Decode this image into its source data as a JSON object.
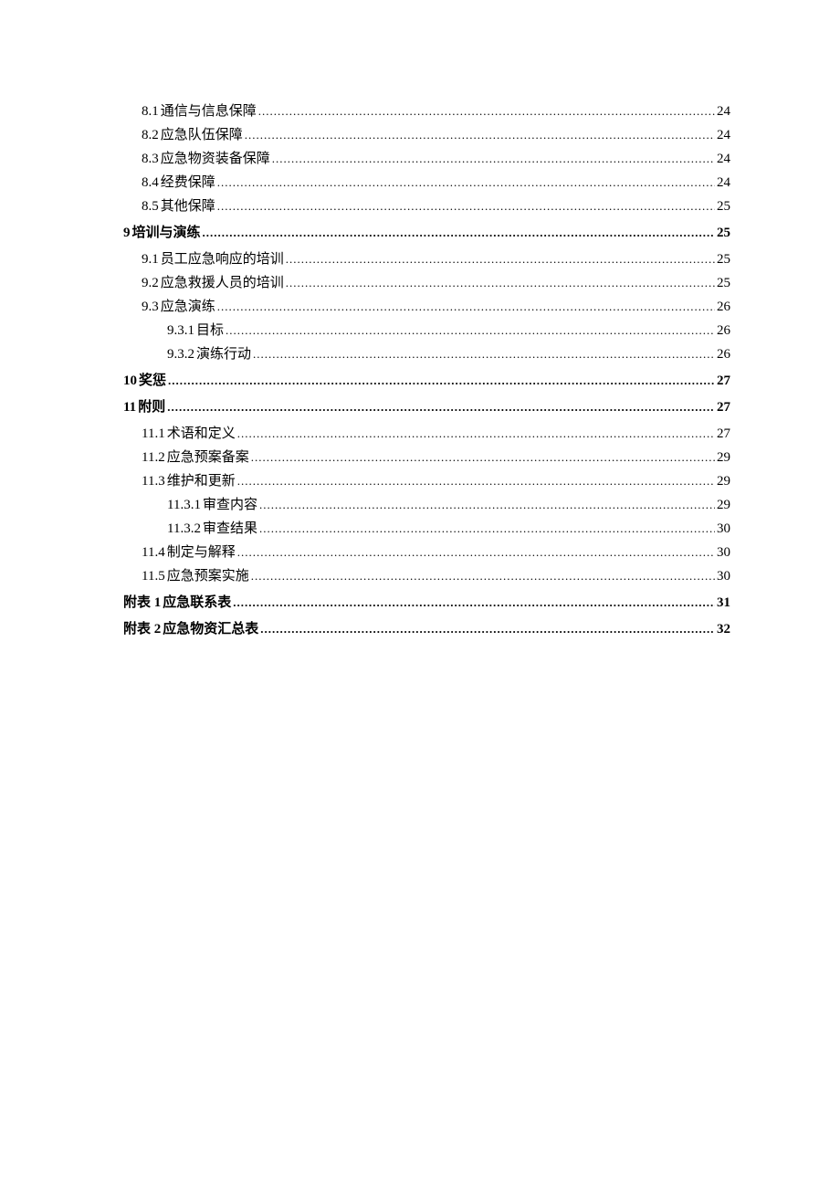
{
  "toc": [
    {
      "level": 2,
      "num": "8.1",
      "title": "通信与信息保障",
      "page": "24"
    },
    {
      "level": 2,
      "num": "8.2",
      "title": "应急队伍保障",
      "page": "24"
    },
    {
      "level": 2,
      "num": "8.3",
      "title": "应急物资装备保障",
      "page": "24"
    },
    {
      "level": 2,
      "num": "8.4",
      "title": "经费保障",
      "page": "24"
    },
    {
      "level": 2,
      "num": "8.5",
      "title": "其他保障",
      "page": "25"
    },
    {
      "level": 1,
      "num": "9",
      "title": "培训与演练",
      "page": "25"
    },
    {
      "level": 2,
      "num": "9.1",
      "title": "员工应急响应的培训",
      "page": "25"
    },
    {
      "level": 2,
      "num": "9.2",
      "title": "应急救援人员的培训",
      "page": "25"
    },
    {
      "level": 2,
      "num": "9.3",
      "title": "应急演练",
      "page": "26"
    },
    {
      "level": 3,
      "num": "9.3.1",
      "title": "目标",
      "page": "26"
    },
    {
      "level": 3,
      "num": "9.3.2",
      "title": "演练行动",
      "page": "26"
    },
    {
      "level": 1,
      "num": "10",
      "title": "奖惩",
      "page": "27"
    },
    {
      "level": 1,
      "num": "11",
      "title": "附则",
      "page": "27"
    },
    {
      "level": 2,
      "num": "11.1",
      "title": "术语和定义",
      "page": "27"
    },
    {
      "level": 2,
      "num": "11.2",
      "title": "应急预案备案",
      "page": "29"
    },
    {
      "level": 2,
      "num": "11.3",
      "title": "维护和更新",
      "page": "29"
    },
    {
      "level": 3,
      "num": "11.3.1",
      "title": "审查内容",
      "page": "29"
    },
    {
      "level": 3,
      "num": "11.3.2",
      "title": " 审查结果",
      "page": "30"
    },
    {
      "level": 2,
      "num": "11.4",
      "title": "制定与解释",
      "page": "30"
    },
    {
      "level": 2,
      "num": "11.5",
      "title": "应急预案实施",
      "page": "30"
    },
    {
      "level": 1,
      "num": "附表 1",
      "title": "应急联系表",
      "page": "31"
    },
    {
      "level": 1,
      "num": "附表 2",
      "title": "应急物资汇总表",
      "page": "32"
    }
  ]
}
